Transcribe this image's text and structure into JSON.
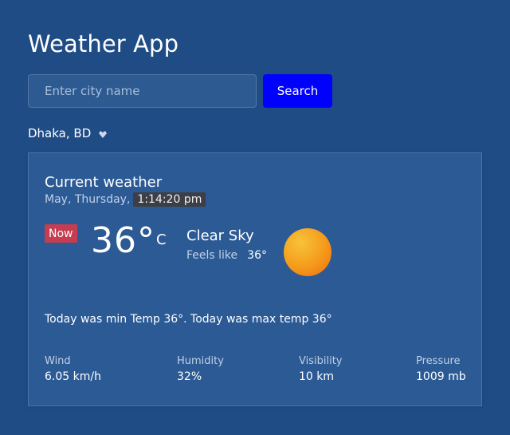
{
  "app": {
    "title": "Weather App"
  },
  "search": {
    "placeholder": "Enter city name",
    "button_label": "Search"
  },
  "location": {
    "text": "Dhaka, BD",
    "icon": "location-arrow-icon"
  },
  "card": {
    "title": "Current weather",
    "date_text": "May, Thursday,",
    "time_text": "1:14:20 pm",
    "now_label": "Now",
    "temperature": "36°",
    "unit": "C",
    "condition": "Clear Sky",
    "feels_label": "Feels like",
    "feels_value": "36°",
    "summary": "Today was min Temp 36°. Today was max temp 36°",
    "weather_icon": "sun-icon",
    "stats": [
      {
        "label": "Wind",
        "value": "6.05 km/h"
      },
      {
        "label": "Humidity",
        "value": "32%"
      },
      {
        "label": "Visibility",
        "value": "10 km"
      },
      {
        "label": "Pressure",
        "value": "1009 mb"
      }
    ]
  },
  "colors": {
    "background": "#1f4c85",
    "card_background": "#2b5a95",
    "search_button": "#0000ff",
    "now_badge": "#c63c51",
    "sun_start": "#f7c33a",
    "sun_end": "#ef6914"
  }
}
